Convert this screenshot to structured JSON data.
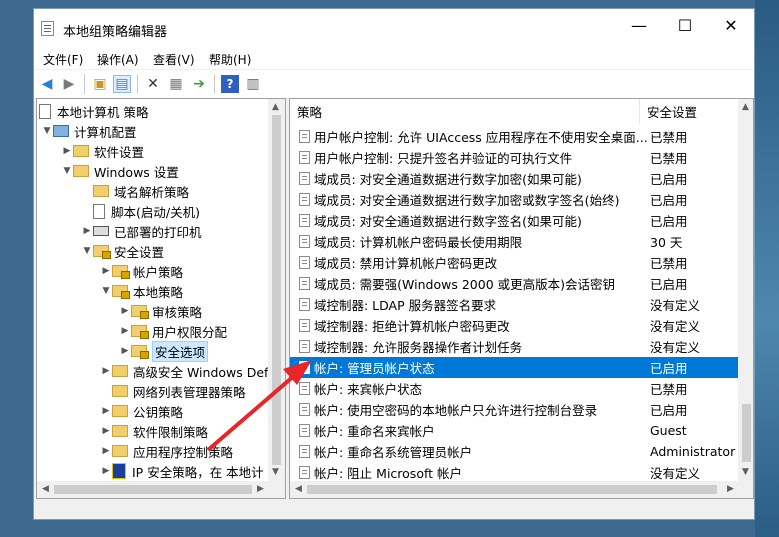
{
  "window": {
    "title": "本地组策略编辑器"
  },
  "controls": {
    "minimize": "—",
    "maximize": "☐",
    "close": "✕"
  },
  "menu": [
    "文件(F)",
    "操作(A)",
    "查看(V)",
    "帮助(H)"
  ],
  "tree": {
    "root": "本地计算机 策略",
    "computer_config": "计算机配置",
    "software_settings": "软件设置",
    "windows_settings": "Windows 设置",
    "dns_policy": "域名解析策略",
    "scripts": "脚本(启动/关机)",
    "printers": "已部署的打印机",
    "security_settings": "安全设置",
    "account_policy": "帐户策略",
    "local_policy": "本地策略",
    "audit_policy": "审核策略",
    "user_rights": "用户权限分配",
    "security_options": "安全选项",
    "firewall": "高级安全 Windows Defe",
    "network_list": "网络列表管理器策略",
    "public_key": "公钥策略",
    "software_restriction": "软件限制策略",
    "app_control": "应用程序控制策略",
    "ip_security": "IP 安全策略，在 本地计"
  },
  "list": {
    "col_policy": "策略",
    "col_setting": "安全设置",
    "rows": [
      {
        "name": "用户帐户控制: 允许 UIAccess 应用程序在不使用安全桌面...",
        "value": "已禁用"
      },
      {
        "name": "用户帐户控制: 只提升签名并验证的可执行文件",
        "value": "已禁用"
      },
      {
        "name": "域成员: 对安全通道数据进行数字加密(如果可能)",
        "value": "已启用"
      },
      {
        "name": "域成员: 对安全通道数据进行数字加密或数字签名(始终)",
        "value": "已启用"
      },
      {
        "name": "域成员: 对安全通道数据进行数字签名(如果可能)",
        "value": "已启用"
      },
      {
        "name": "域成员: 计算机帐户密码最长使用期限",
        "value": "30 天"
      },
      {
        "name": "域成员: 禁用计算机帐户密码更改",
        "value": "已禁用"
      },
      {
        "name": "域成员: 需要强(Windows 2000 或更高版本)会话密钥",
        "value": "已启用"
      },
      {
        "name": "域控制器: LDAP 服务器签名要求",
        "value": "没有定义"
      },
      {
        "name": "域控制器: 拒绝计算机帐户密码更改",
        "value": "没有定义"
      },
      {
        "name": "域控制器: 允许服务器操作者计划任务",
        "value": "没有定义"
      },
      {
        "name": "帐户: 管理员帐户状态",
        "value": "已启用"
      },
      {
        "name": "帐户: 来宾帐户状态",
        "value": "已禁用"
      },
      {
        "name": "帐户: 使用空密码的本地帐户只允许进行控制台登录",
        "value": "已启用"
      },
      {
        "name": "帐户: 重命名来宾帐户",
        "value": "Guest"
      },
      {
        "name": "帐户: 重命名系统管理员帐户",
        "value": "Administrator"
      },
      {
        "name": "帐户: 阻止 Microsoft 帐户",
        "value": "没有定义"
      }
    ],
    "selected_index": 11
  },
  "colors": {
    "selection": "#0078d7",
    "arrow": "#e8262a"
  }
}
